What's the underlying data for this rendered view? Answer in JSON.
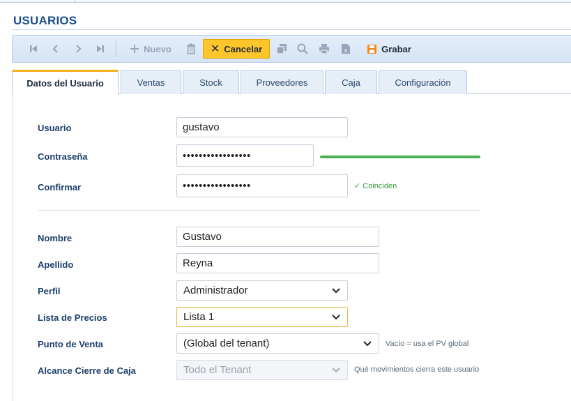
{
  "page": {
    "title": "USUARIOS"
  },
  "toolbar": {
    "nuevo_label": "Nuevo",
    "cancelar_label": "Cancelar",
    "grabar_label": "Grabar",
    "icons": [
      "first-record-icon",
      "prev-record-icon",
      "next-record-icon",
      "last-record-icon",
      "plus-icon",
      "trash-icon",
      "copy-icon",
      "search-icon",
      "print-icon",
      "excel-icon",
      "save-icon"
    ]
  },
  "tabs": [
    {
      "label": "Datos del Usuario",
      "active": true
    },
    {
      "label": "Ventas"
    },
    {
      "label": "Stock"
    },
    {
      "label": "Proveedores"
    },
    {
      "label": "Caja"
    },
    {
      "label": "Configuración"
    }
  ],
  "form": {
    "usuario": {
      "label": "Usuario",
      "value": "gustavo"
    },
    "contrasena": {
      "label": "Contraseña",
      "value": "•••••••••••••••••",
      "strength": 1.0
    },
    "confirmar": {
      "label": "Confirmar",
      "value": "•••••••••••••••••",
      "match_text": "✓ Coinciden"
    },
    "nombre": {
      "label": "Nombre",
      "value": "Gustavo"
    },
    "apellido": {
      "label": "Apellido",
      "value": "Reyna"
    },
    "perfil": {
      "label": "Perfil",
      "value": "Administrador"
    },
    "lista_precios": {
      "label": "Lista de Precios",
      "value": "Lista 1"
    },
    "punto_venta": {
      "label": "Punto de Venta",
      "value": "(Global del tenant)",
      "hint": "Vacío = usa el PV global"
    },
    "alcance_cierre": {
      "label": "Alcance Cierre de Caja",
      "value": "Todo el Tenant",
      "hint": "Qué movimientos cierra este usuario"
    }
  },
  "colors": {
    "accent": "#ffc62b",
    "title": "#1b4f8a",
    "label": "#1b3f6b",
    "success": "#4caf50"
  }
}
